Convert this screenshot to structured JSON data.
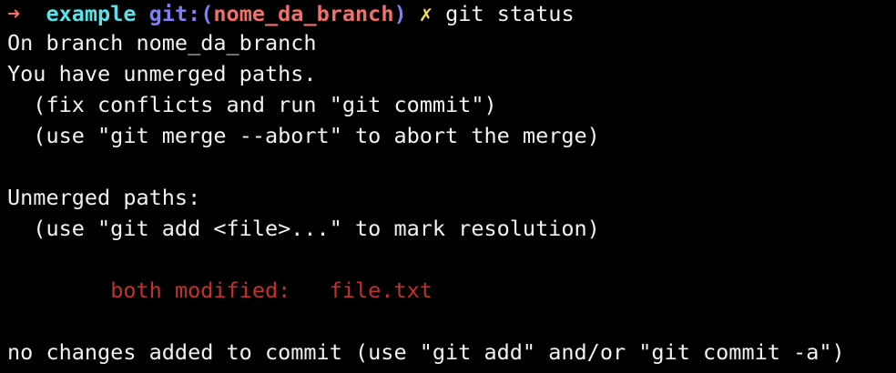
{
  "prompt": {
    "arrow": "➜",
    "directory": "example",
    "git_prefix": "git:(",
    "branch": "nome_da_branch",
    "git_suffix": ")",
    "dirty_marker": "✗",
    "command": "git status"
  },
  "output": {
    "line_branch": "On branch nome_da_branch",
    "line_unmerged": "You have unmerged paths.",
    "hint_fix": "  (fix conflicts and run \"git commit\")",
    "hint_abort": "  (use \"git merge --abort\" to abort the merge)",
    "unmerged_header": "Unmerged paths:",
    "hint_add": "  (use \"git add <file>...\" to mark resolution)",
    "conflict_status": "both modified:",
    "conflict_file": "file.txt",
    "footer": "no changes added to commit (use \"git add\" and/or \"git commit -a\")"
  },
  "colors": {
    "background": "#000000",
    "text": "#f2f2f2",
    "arrow": "#f0706a",
    "directory": "#57e3e8",
    "git_label": "#7f7ff8",
    "branch": "#f0706a",
    "dirty_marker": "#f5e35a",
    "conflict": "#c7302a"
  },
  "icons": {
    "arrow": "arrow-right-icon",
    "dirty_marker": "cross-mark-icon"
  }
}
